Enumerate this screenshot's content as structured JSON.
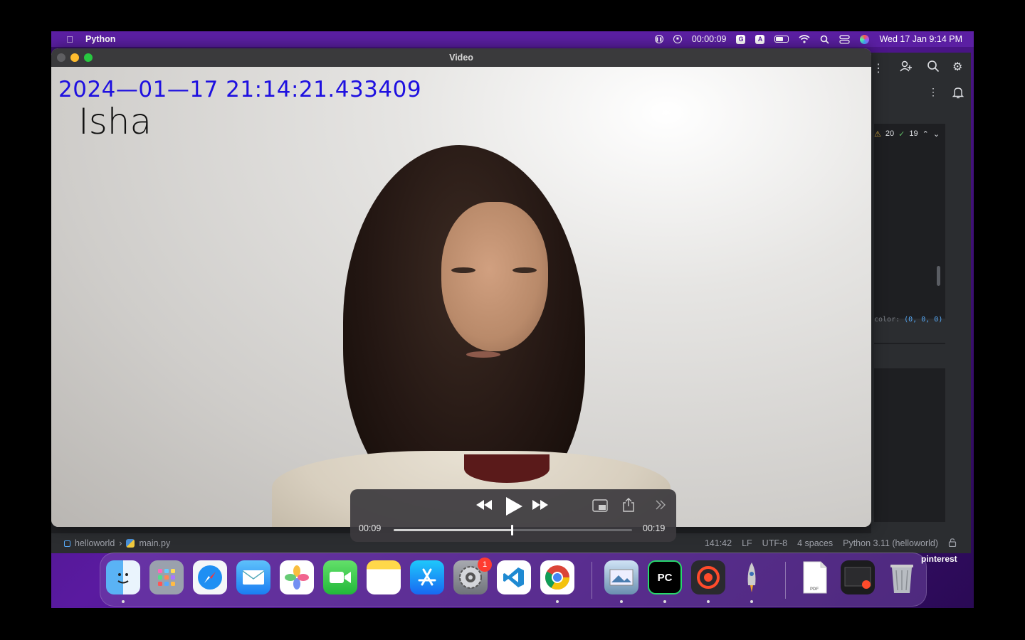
{
  "menubar": {
    "app_name": "Python",
    "recording_time": "00:00:09",
    "clock": "Wed 17 Jan  9:14 PM",
    "input_badge": "A"
  },
  "video_window": {
    "title": "Video",
    "timestamp_overlay": "2024—01—17 21:14:21.433409",
    "name_overlay": "Isha"
  },
  "player": {
    "current_time": "00:09",
    "total_time": "00:19",
    "progress": 0.497
  },
  "ide": {
    "breadcrumb_project": "helloworld",
    "breadcrumb_file": "main.py",
    "warnings": "20",
    "checks": "19",
    "code_hint_label": "color:",
    "code_hint_value": "(0, 0, 0)",
    "status": {
      "position": "141:42",
      "line_sep": "LF",
      "encoding": "UTF-8",
      "indent": "4 spaces",
      "interpreter": "Python 3.11 (helloworld)"
    }
  },
  "dock": {
    "settings_badge": "1",
    "pycharm_label": "PC",
    "pinterest_text": "pinterest"
  }
}
